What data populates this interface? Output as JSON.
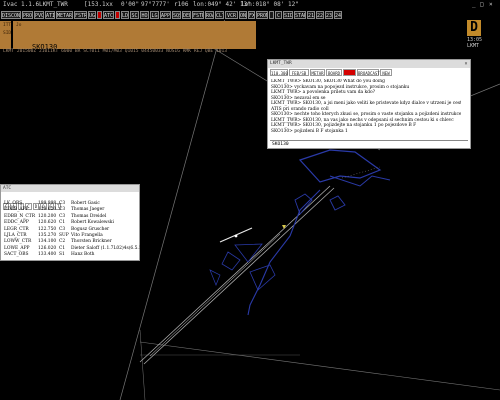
{
  "titlebar": {
    "app": "Ivac 1.1.6",
    "position": "LKMT_TWR",
    "frequency": "[153.1xx",
    "fields": [
      "0'00\"",
      "97°7777'",
      "r106",
      "lon:049° 42' 13\"",
      "lon:018° 08' 12\""
    ]
  },
  "toolbar": {
    "buttons": [
      "DISCON",
      "PROF",
      "PVO",
      "ATIS",
      "METAR",
      "FSTR",
      "UG",
      "",
      "ATC",
      "",
      "LD",
      "SC",
      "HO",
      "LG",
      "APP",
      "SQS",
      "DEP",
      "FSTR",
      "ROA",
      "CLT",
      "VCR",
      "ON",
      "FX",
      "PROM",
      "",
      "C",
      "SID",
      "STAR",
      "21",
      "22",
      "23",
      "24"
    ],
    "red_indices": [
      7,
      9
    ]
  },
  "right_panel": {
    "badge": "D",
    "time_line1": "13:05",
    "time_line2": "LKMT"
  },
  "metar": {
    "text": "LKMT 201500Z 21011KT 6000 BR SCT011 M01/M03 Q1015 04450033 NOSIG RMK REJ QBE 1013"
  },
  "flightstrip": {
    "header": [
      "ITT",
      "Jo",
      "SID",
      "",
      "",
      "",
      "",
      ""
    ],
    "callsign": "SKO130"
  },
  "chat": {
    "title": "LKMT_TWR",
    "close": "×",
    "tabs": [
      "110.300",
      "FEB/SB",
      "METAR",
      "BOARD",
      "",
      "BROADCAST",
      "NEW"
    ],
    "red_tab": 4,
    "messages": [
      "LKMT_TWR> SKO130, SKO130 What do you doing",
      "SKO130> vyckavam na popojezd instrukce, prosim o stojanku",
      "LKMT_TWR> a povolenka priletu vam da kdo?",
      "SKO130> nezaval em se",
      "LKMT_TWR> SKO130, a jsi meni jako veliti ke pristevate kdyz dialce v utrzeni je cesty22 to je tou",
      "ATIS pri orando radio coll",
      "SKO130> nechte toho kterych zkusi se, prosim o vaste stojanku a pojizdeni instrukce",
      "LKMT_TWR> SKO130, na vas jako nechs v odepsani sl sechnim cestou ki s chlevc",
      "LKMT_TWR> SKO130, pojizdejte na stojanku 1 po pojezdove B F",
      "SKO130> pojizdeni B F stojanka 1"
    ],
    "input": "SKO130"
  },
  "atc_list": {
    "title": "ATC",
    "tabs": [
      "C",
      "A",
      "T",
      "C",
      "D",
      "Q",
      "S",
      "T"
    ],
    "rows": [
      [
        "LK_OBS",
        "199.998",
        "C3",
        "Robert Gasic"
      ],
      [
        "EDBB_APP",
        "119.620",
        "C3",
        "Thomas Jaeger"
      ],
      [
        "EDBB_N_CTR",
        "120.200",
        "C3",
        "Thomas Dreidel"
      ],
      [
        "EDDC_APP",
        "120.620",
        "C1",
        "Robert Kowalewski"
      ],
      [
        "LEGR_CTR",
        "122.750",
        "C3",
        "Bogusz Gruscher"
      ],
      [
        "LJLA_CTR",
        "135.270",
        "SUP",
        "Vito Frangella"
      ],
      [
        "LOWW_CTR",
        "134.100",
        "C2",
        "Thorsten Brickner"
      ],
      [
        "LOWE_APP",
        "126.020",
        "C1",
        "Dieter Saloff (1.1.7L02)4s(6.5.1)"
      ],
      [
        "SACT_OBS",
        "133.400",
        "S1",
        "Hanz Both"
      ]
    ]
  }
}
